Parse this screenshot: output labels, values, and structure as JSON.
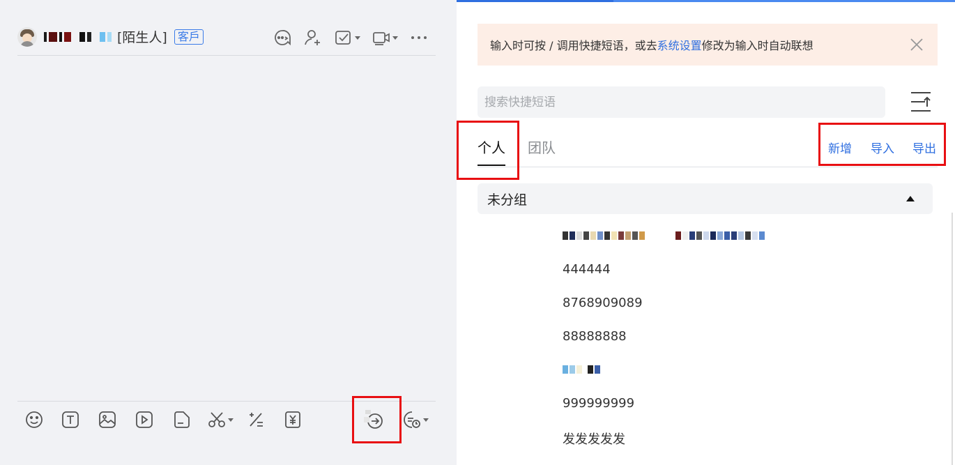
{
  "chat": {
    "contact_tag": "[陌生人]",
    "badge": "客戶"
  },
  "quick_phrases": {
    "notice": {
      "prefix": "输入时可按 / 调用快捷短语，或去",
      "link": "系统设置",
      "suffix": "修改为输入时自动联想"
    },
    "search_placeholder": "搜索快捷短语",
    "tabs": [
      {
        "label": "个人",
        "active": true
      },
      {
        "label": "团队",
        "active": false
      }
    ],
    "actions": {
      "add": "新增",
      "import": "导入",
      "export": "导出"
    },
    "group": {
      "name": "未分组",
      "expanded": true
    },
    "items": [
      {
        "text": "444444"
      },
      {
        "text": "8768909089"
      },
      {
        "text": "88888888"
      },
      {
        "text": "999999999"
      },
      {
        "text": "发发发发发"
      }
    ]
  },
  "colors": {
    "accent": "#2f6fe0",
    "highlight_box": "#e80f12",
    "notice_bg": "#fdeee6"
  }
}
